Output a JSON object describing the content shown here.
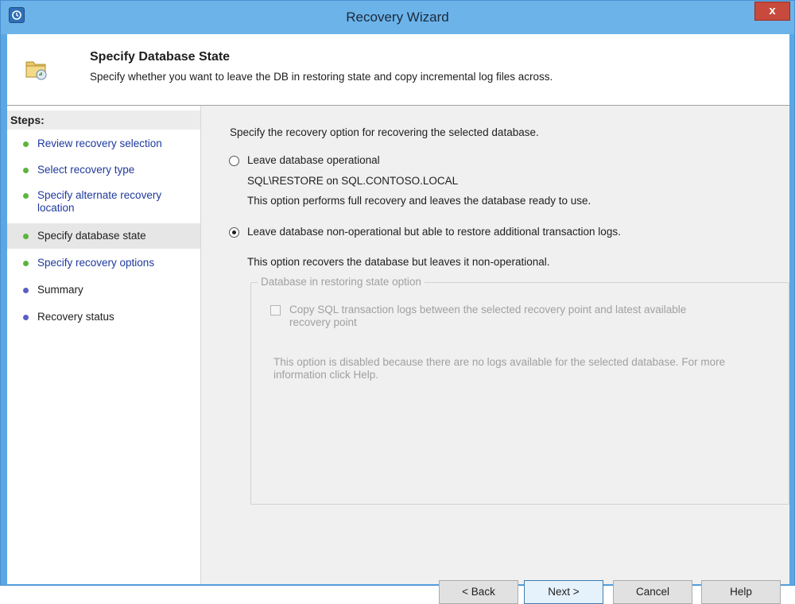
{
  "window": {
    "title": "Recovery Wizard",
    "close_label": "x"
  },
  "header": {
    "title": "Specify Database State",
    "description": "Specify whether you want to leave the DB in restoring state and copy incremental log files across."
  },
  "sidebar": {
    "heading": "Steps:",
    "steps": [
      {
        "label": "Review recovery selection",
        "state": "completed"
      },
      {
        "label": "Select recovery type",
        "state": "completed"
      },
      {
        "label": "Specify alternate recovery location",
        "state": "completed"
      },
      {
        "label": "Specify database state",
        "state": "current"
      },
      {
        "label": "Specify recovery options",
        "state": "completed"
      },
      {
        "label": "Summary",
        "state": "pending"
      },
      {
        "label": "Recovery status",
        "state": "pending"
      }
    ]
  },
  "main": {
    "intro": "Specify the recovery option for recovering the selected database.",
    "option1": {
      "label": "Leave database operational",
      "target": "SQL\\RESTORE on SQL.CONTOSO.LOCAL",
      "description": "This option performs full recovery and leaves the database ready to use.",
      "selected": false
    },
    "option2": {
      "label": "Leave database non-operational but able to restore additional transaction logs.",
      "description": "This option recovers the database but leaves it non-operational.",
      "selected": true
    },
    "group": {
      "label": "Database in restoring state option",
      "checkbox_line1": "Copy SQL transaction logs between the selected recovery point and latest available",
      "checkbox_line2": "recovery point",
      "checkbox_checked": false,
      "note_line1": "This option is disabled because there are no logs available for the selected database. For more",
      "note_line2": "information click Help."
    }
  },
  "buttons": {
    "back": "< Back",
    "next": "Next >",
    "cancel": "Cancel",
    "help": "Help"
  },
  "colors": {
    "completed_dot": "#5bb53a",
    "pending_dot": "#5a5fc4",
    "link_text": "#1f3a9e",
    "title_bar": "#6cb3ea"
  }
}
